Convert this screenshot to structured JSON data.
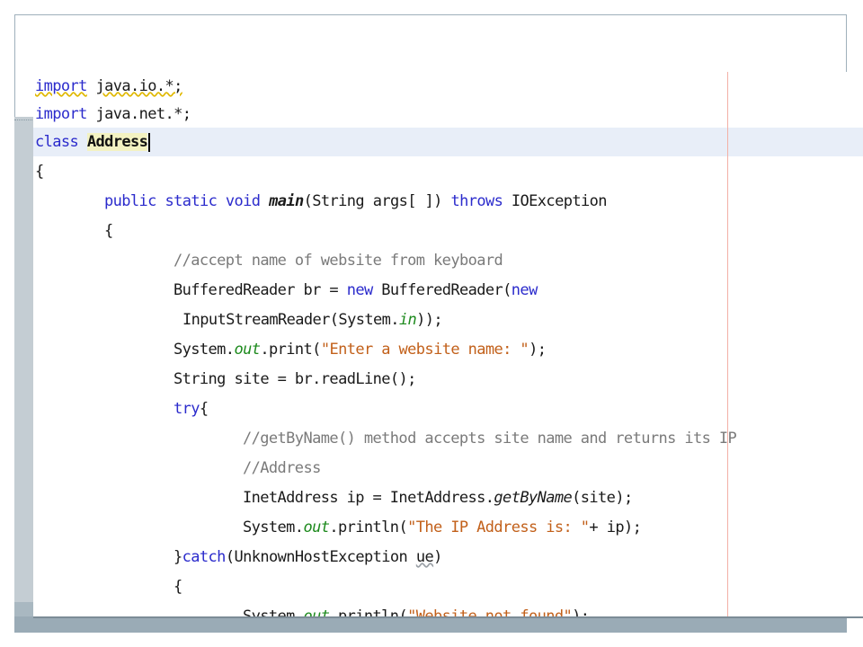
{
  "editor": {
    "lines": [
      [
        "import",
        "java.io.*;"
      ],
      [
        "import",
        "java.net.*;"
      ],
      [
        "class",
        "Address"
      ],
      [
        "{"
      ],
      [
        "public static void",
        "main",
        "(String args[ ])",
        "throws",
        "IOException"
      ],
      [
        "{"
      ],
      [
        "//accept name of website from keyboard"
      ],
      [
        "BufferedReader br =",
        "new",
        "BufferedReader(",
        "new"
      ],
      [
        "InputStreamReader(System.",
        "in",
        "));"
      ],
      [
        "System.",
        "out",
        ".print(",
        "\"Enter a website name: \"",
        ");"
      ],
      [
        "String site = br.readLine();"
      ],
      [
        "try",
        "{"
      ],
      [
        "//getByName() method accepts site name and returns its IP"
      ],
      [
        "//Address"
      ],
      [
        "InetAddress ip = InetAddress.",
        "getByName",
        "(site);"
      ],
      [
        "System.",
        "out",
        ".println(",
        "\"The IP Address is: \"",
        "+ ip);"
      ],
      [
        "}",
        "catch",
        "(UnknownHostException",
        "ue",
        ")"
      ],
      [
        "{"
      ],
      [
        "System.",
        "out",
        ".println(",
        "\"Website not found\"",
        ");"
      ]
    ]
  }
}
